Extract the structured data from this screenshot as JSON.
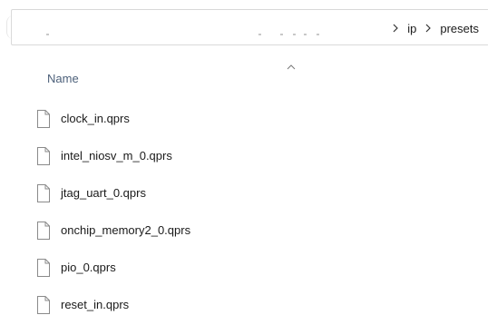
{
  "address_bar": {
    "breadcrumbs": [
      "ip",
      "presets"
    ]
  },
  "columns": {
    "name_label": "Name"
  },
  "files": [
    {
      "name": "clock_in.qprs",
      "icon": "file-icon"
    },
    {
      "name": "intel_niosv_m_0.qprs",
      "icon": "file-icon"
    },
    {
      "name": "jtag_uart_0.qprs",
      "icon": "file-icon"
    },
    {
      "name": "onchip_memory2_0.qprs",
      "icon": "file-icon"
    },
    {
      "name": "pio_0.qprs",
      "icon": "file-icon"
    },
    {
      "name": "reset_in.qprs",
      "icon": "file-icon"
    }
  ],
  "colors": {
    "column_header_text": "#4c607a",
    "border": "#d9d9d9"
  }
}
